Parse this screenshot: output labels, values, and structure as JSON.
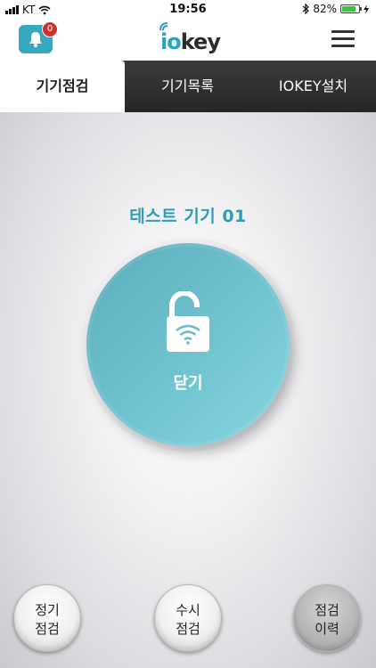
{
  "status_bar": {
    "carrier": "KT",
    "time": "19:56",
    "battery_percent_text": "82%",
    "battery_level": 0.82
  },
  "header": {
    "notification_count": "0",
    "logo_io": "io",
    "logo_key": "key"
  },
  "tabs": [
    {
      "label": "기기점검",
      "active": true
    },
    {
      "label": "기기목록",
      "active": false
    },
    {
      "label": "IOKEY설치",
      "active": false
    }
  ],
  "main": {
    "device_name": "테스트 기기 01",
    "lock_button_label": "닫기"
  },
  "bottom_buttons": [
    {
      "line1": "정기",
      "line2": "점검"
    },
    {
      "line1": "수시",
      "line2": "점검"
    },
    {
      "line1": "점검",
      "line2": "이력"
    }
  ],
  "colors": {
    "accent": "#2b9fb8",
    "lock_circle": "#72c3d0",
    "badge": "#d0302b",
    "tab_bar": "#2e2e2e"
  }
}
